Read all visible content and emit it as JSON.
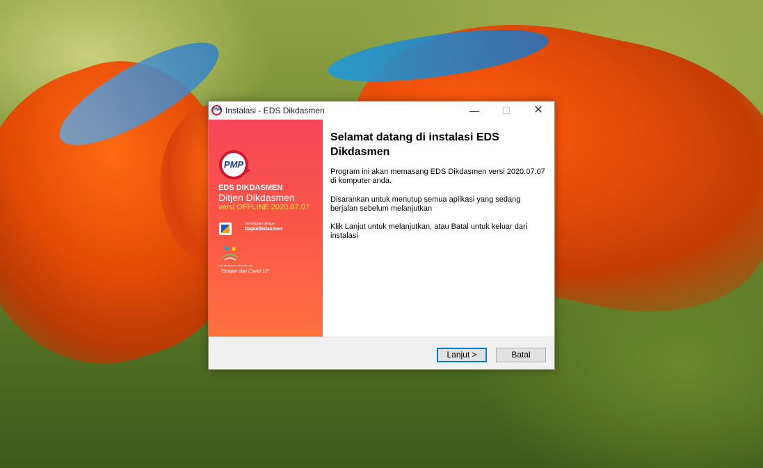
{
  "window": {
    "title": "Instalasi - EDS Dikdasmen",
    "minimize_symbol": "—",
    "maximize_symbol": "☐",
    "close_symbol": "✕",
    "title_icon_text": "PMP"
  },
  "sidebar": {
    "logo_text": "PMP",
    "brand": "EDS DIKDASMEN",
    "org": "Ditjen Dikdasmen",
    "version": "versi OFFLINE 2020.07.07",
    "integrated_small": "Terintegrasi dengan",
    "integrated_name": "Dapodikdasmen",
    "hari_caption": "HARI PENDIDIKAN NASIONAL 2020",
    "hari_tagline": "\"Belajar dari Covid-19\"",
    "colors": {
      "gradient_top": "#f6465a",
      "gradient_bottom": "#ff7040",
      "version": "#ffe14a"
    }
  },
  "content": {
    "heading": "Selamat datang di instalasi EDS Dikdasmen",
    "paragraph1": "Program ini akan memasang EDS Dikdasmen versi 2020.07.07 di komputer anda.",
    "paragraph2": "Disarankan untuk menutup semua aplikasi yang sedang berjalan sebelum melanjutkan",
    "paragraph3": "Klik Lanjut untuk melanjutkan, atau Batal untuk keluar dari instalasi"
  },
  "footer": {
    "next_label": "Lanjut >",
    "cancel_label": "Batal",
    "accent": "#0078d7"
  }
}
